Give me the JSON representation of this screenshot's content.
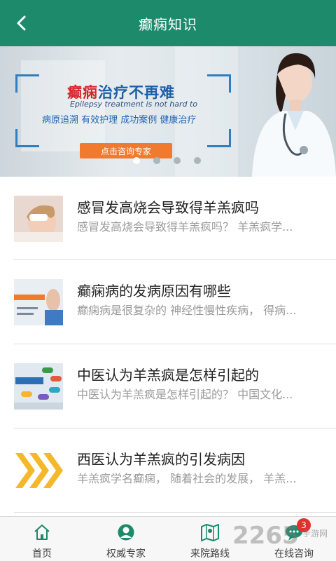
{
  "header": {
    "title": "癫痫知识",
    "back_icon": "chevron-left-icon"
  },
  "banner": {
    "headline_red": "癫痫",
    "headline_blue": "治疗不再难",
    "subtitle": "Epilepsy treatment is not hard to",
    "tags": "病原追溯  有效护理  成功案例  健康治疗",
    "cta": "点击咨询专家",
    "slides": 4,
    "active_slide": 1
  },
  "articles": [
    {
      "title": "感冒发高烧会导致得羊羔疯吗",
      "desc": "感冒发高烧会导致得羊羔疯吗？ 羊羔疯学..."
    },
    {
      "title": "癫痫病的发病原因有哪些",
      "desc": "癫痫病是很复杂的 神经性慢性疾病， 得病..."
    },
    {
      "title": "中医认为羊羔疯是怎样引起的",
      "desc": "中医认为羊羔疯是怎样引起的？ 中国文化..."
    },
    {
      "title": "西医认为羊羔疯的引发病因",
      "desc": "羊羔疯学名癫痫， 随着社会的发展， 羊羔..."
    }
  ],
  "tabbar": [
    {
      "label": "首页",
      "icon": "home-icon"
    },
    {
      "label": "权威专家",
      "icon": "expert-icon"
    },
    {
      "label": "来院路线",
      "icon": "map-icon"
    },
    {
      "label": "在线咨询",
      "icon": "chat-icon"
    }
  ],
  "badge_count": "3",
  "watermark": {
    "main": "2265",
    "sub": "手游网"
  },
  "colors": {
    "header": "#1c8a6b",
    "accent": "#1c8a6b",
    "badge": "#e0312f"
  }
}
